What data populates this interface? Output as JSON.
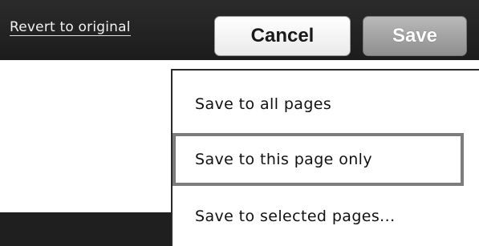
{
  "toolbar": {
    "revert_label": "Revert to original",
    "cancel_label": "Cancel",
    "save_label": "Save"
  },
  "save_menu": {
    "items": [
      {
        "label": "Save to all pages"
      },
      {
        "label": "Save to this page only",
        "highlighted": true
      },
      {
        "label": "Save to selected pages..."
      }
    ]
  },
  "colors": {
    "toolbar_bg": "#1c1c1c",
    "save_button_bg": "#9e9e9e",
    "highlight_border": "#7d7d7d"
  }
}
